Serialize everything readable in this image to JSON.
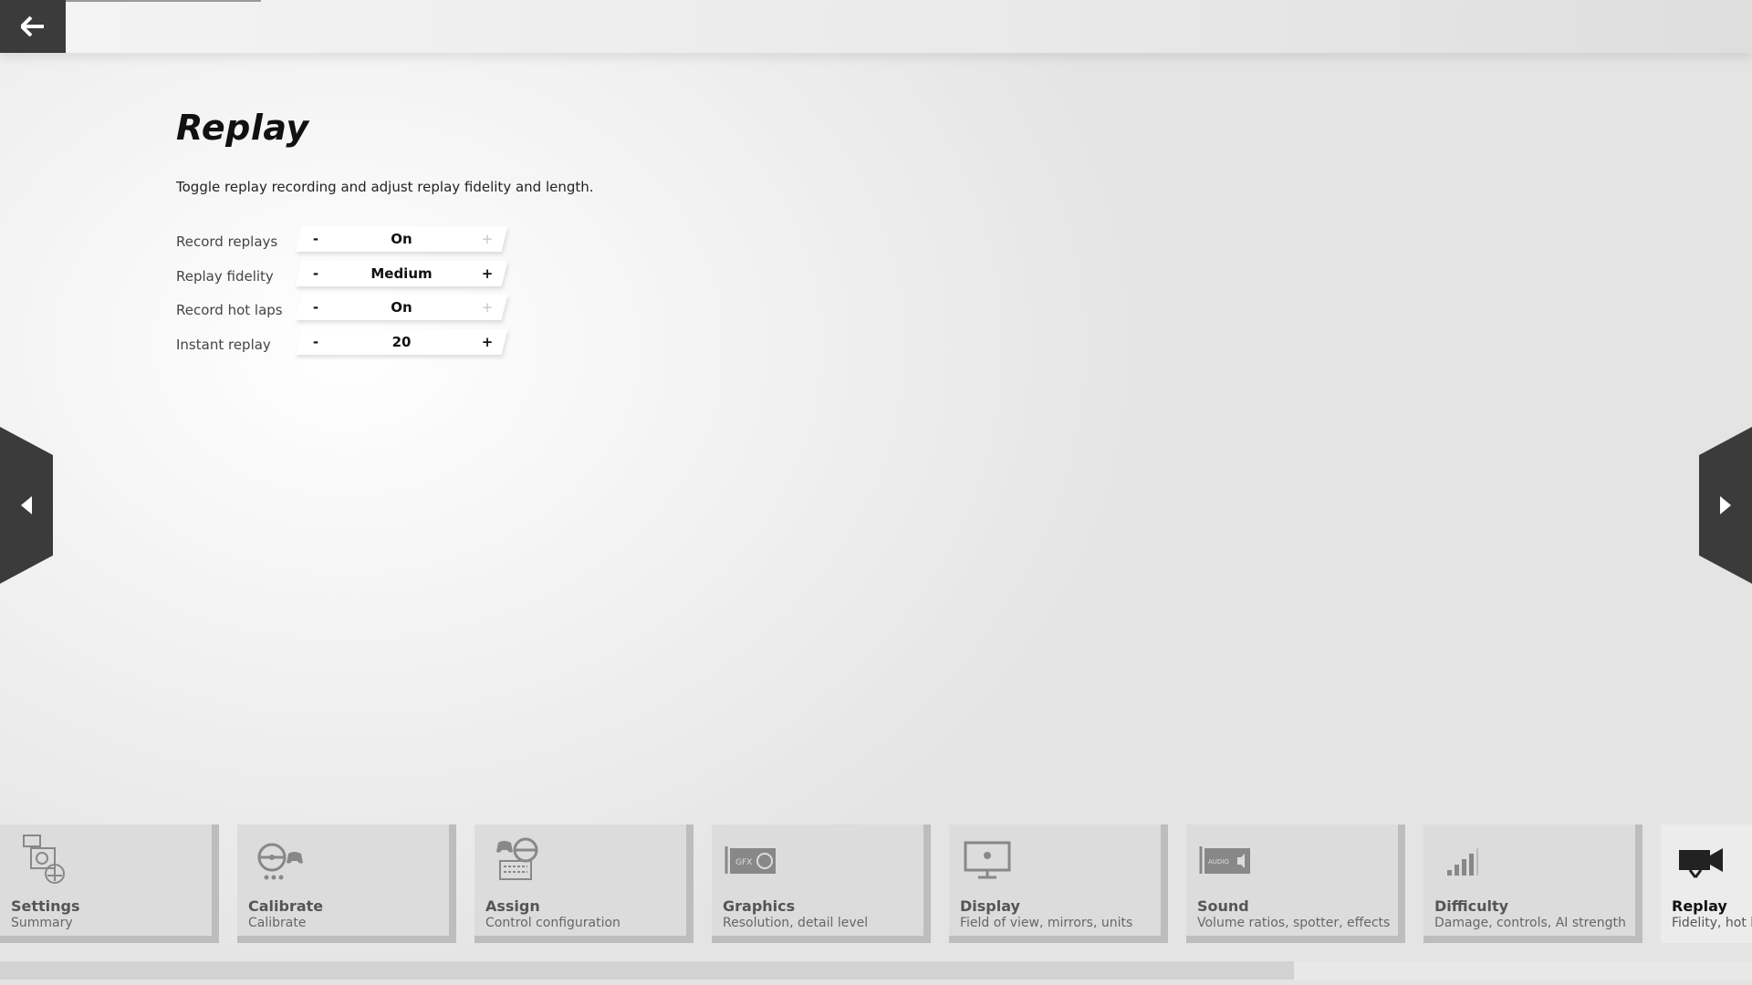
{
  "header": {
    "back_icon": "arrow-left-icon"
  },
  "page": {
    "title": "Replay",
    "description": "Toggle replay recording and adjust replay fidelity and length."
  },
  "settings": [
    {
      "label": "Record replays",
      "value": "On",
      "minus": "-",
      "plus": "+",
      "plus_enabled": false
    },
    {
      "label": "Replay fidelity",
      "value": "Medium",
      "minus": "-",
      "plus": "+",
      "plus_enabled": true
    },
    {
      "label": "Record hot laps",
      "value": "On",
      "minus": "-",
      "plus": "+",
      "plus_enabled": false
    },
    {
      "label": "Instant replay",
      "value": "20",
      "minus": "-",
      "plus": "+",
      "plus_enabled": true
    }
  ],
  "navigation": {
    "prev_icon": "chevron-left-icon",
    "next_icon": "chevron-right-icon"
  },
  "tiles": [
    {
      "title": "Settings",
      "subtitle": "Summary",
      "icon": "settings-summary-icon"
    },
    {
      "title": "Calibrate",
      "subtitle": "Calibrate",
      "icon": "wheel-gamepad-icon"
    },
    {
      "title": "Assign",
      "subtitle": "Control configuration",
      "icon": "controls-icon"
    },
    {
      "title": "Graphics",
      "subtitle": "Resolution, detail level",
      "icon": "graphics-card-icon"
    },
    {
      "title": "Display",
      "subtitle": "Field of view, mirrors, units",
      "icon": "monitor-icon"
    },
    {
      "title": "Sound",
      "subtitle": "Volume ratios, spotter, effects",
      "icon": "sound-card-icon"
    },
    {
      "title": "Difficulty",
      "subtitle": "Damage, controls, AI strength",
      "icon": "signal-bars-icon"
    },
    {
      "title": "Replay",
      "subtitle": "Fidelity, hot l",
      "icon": "video-camera-icon",
      "active": true
    }
  ],
  "colors": {
    "dark": "#3b3b3b",
    "tile": "#dcdcdc",
    "tile_shadow": "#bdbdbd"
  }
}
